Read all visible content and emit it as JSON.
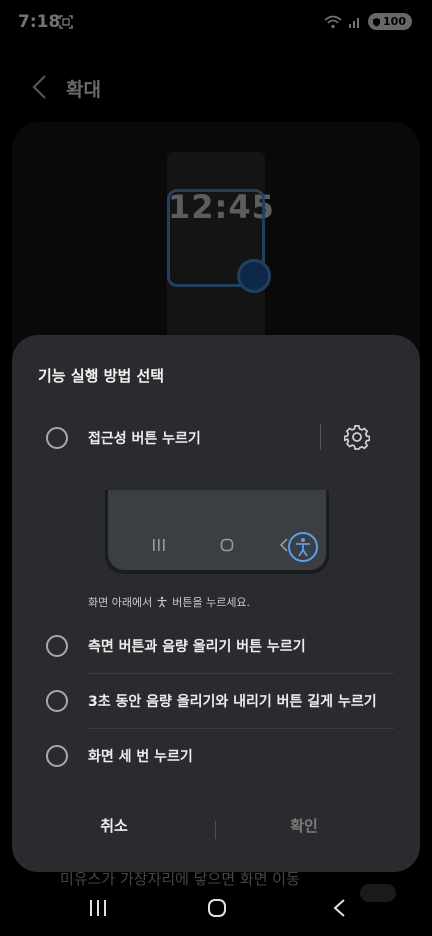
{
  "status_bar": {
    "time": "7:18",
    "battery": "100"
  },
  "app": {
    "title": "확대",
    "magnifier_time": "12:45",
    "background_text": "미유스가 가장자리에 닿으면 화면 이동"
  },
  "dialog": {
    "title": "기능 실행 방법 선택",
    "options": [
      {
        "label": "접근성 버튼 누르기",
        "selected": false
      },
      {
        "label": "측면 버튼과 음량 올리기 버튼 누르기",
        "selected": false
      },
      {
        "label": "3초 동안 음량 올리기와 내리기 버튼 길게 누르기",
        "selected": false
      },
      {
        "label": "화면 세 번 누르기",
        "selected": false
      }
    ],
    "hint_prefix": "화면 아래에서",
    "hint_suffix": "버튼을 누르세요.",
    "cancel_label": "취소",
    "ok_label": "확인"
  },
  "colors": {
    "accent": "#4c8ed6",
    "dialog_bg": "#2a2b2e"
  },
  "icons": [
    "screen-record-icon",
    "wifi-icon",
    "signal-icon",
    "battery-icon",
    "back-chevron-icon",
    "gear-icon",
    "accessibility-icon",
    "recents-icon",
    "home-icon",
    "back-icon"
  ]
}
